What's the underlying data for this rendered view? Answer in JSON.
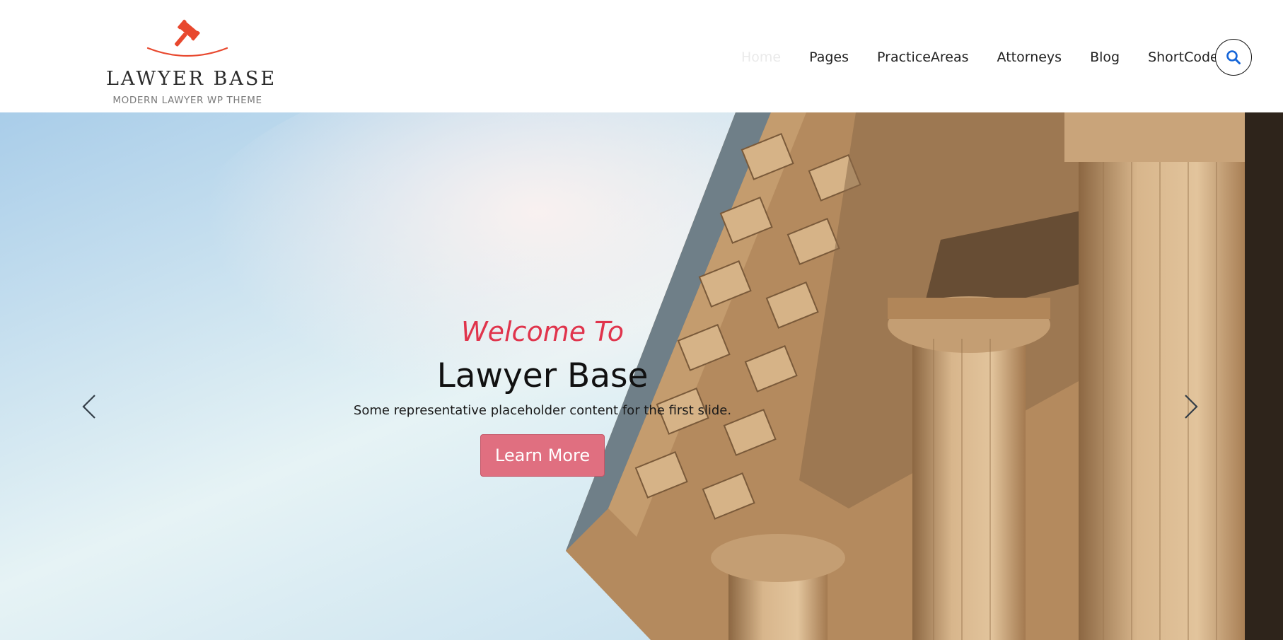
{
  "brand": {
    "name": "LAWYER BASE",
    "tagline": "MODERN LAWYER WP THEME",
    "accent_color": "#e8482e",
    "logo_icon": "gavel-icon"
  },
  "nav": {
    "items": [
      {
        "label": "Home",
        "current": true
      },
      {
        "label": "Pages"
      },
      {
        "label": "PracticeAreas"
      },
      {
        "label": "Attorneys"
      },
      {
        "label": "Blog"
      },
      {
        "label": "ShortCodes"
      }
    ],
    "search_icon": "search-icon"
  },
  "hero": {
    "kicker": "Welcome To",
    "title": "Lawyer Base",
    "text": "Some representative placeholder content for the first slide.",
    "button_label": "Learn More",
    "kicker_color": "#e0344c",
    "button_color": "#e06f80",
    "prev_icon": "chevron-left-icon",
    "next_icon": "chevron-right-icon"
  }
}
